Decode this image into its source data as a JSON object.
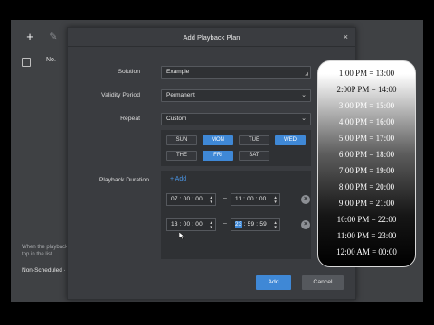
{
  "background_app": {
    "toolbar": {
      "add_icon": "+",
      "edit_icon": "✎"
    },
    "list": {
      "col_no": "No."
    },
    "hint": "When the playback ... top in the list",
    "non_scheduled": "Non-Scheduled ·"
  },
  "dialog": {
    "title": "Add Playback Plan",
    "close_icon": "×",
    "solution": {
      "label": "Solution",
      "value": "Example"
    },
    "validity": {
      "label": "Validity Period",
      "value": "Permanent"
    },
    "repeat": {
      "label": "Repeat",
      "value": "Custom"
    },
    "days": [
      {
        "label": "SUN",
        "selected": false
      },
      {
        "label": "MON",
        "selected": true
      },
      {
        "label": "TUE",
        "selected": false
      },
      {
        "label": "WED",
        "selected": true
      },
      {
        "label": "THE",
        "selected": false
      },
      {
        "label": "FRI",
        "selected": true
      },
      {
        "label": "SAT",
        "selected": false
      }
    ],
    "duration": {
      "label": "Playback Duration",
      "add_label": "+ Add",
      "ranges": [
        {
          "start": "07 : 00 : 00",
          "end": "11 : 00 : 00"
        },
        {
          "start": "13 : 00 : 00",
          "end_hour": "23",
          "end_rest": ": 59 : 59"
        }
      ],
      "separator": "–"
    },
    "buttons": {
      "add": "Add",
      "cancel": "Cancel"
    }
  },
  "overlay": {
    "conversions": [
      "1:00 PM = 13:00",
      "2:00P PM = 14:00",
      "3:00 PM = 15:00",
      "4:00 PM = 16:00",
      "5:00 PM = 17:00",
      "6:00 PM = 18:00",
      "7:00 PM = 19:00",
      "8:00 PM = 20:00",
      "9:00 PM = 21:00",
      "10:00 PM = 22:00",
      "11:00 PM = 23:00",
      "12:00 AM = 00:00"
    ]
  },
  "colors": {
    "accent": "#3f88d6",
    "panel": "#3a3c40",
    "field": "#2f3134"
  }
}
